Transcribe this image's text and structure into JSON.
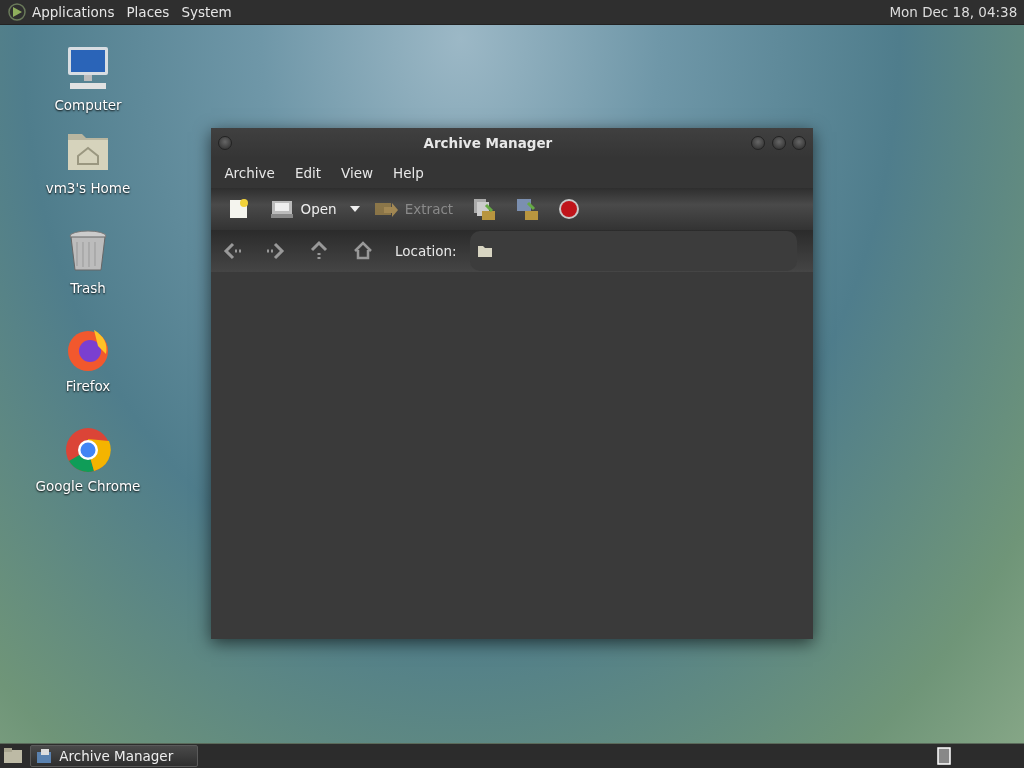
{
  "top_panel": {
    "menus": [
      "Applications",
      "Places",
      "System"
    ],
    "clock": "Mon Dec 18, 04:38"
  },
  "desktop_icons": [
    {
      "kind": "computer",
      "label": "Computer"
    },
    {
      "kind": "home",
      "label": "vm3's Home"
    },
    {
      "kind": "trash",
      "label": "Trash"
    },
    {
      "kind": "firefox",
      "label": "Firefox"
    },
    {
      "kind": "chrome",
      "label": "Google Chrome"
    }
  ],
  "window": {
    "title": "Archive Manager",
    "menu": [
      "Archive",
      "Edit",
      "View",
      "Help"
    ],
    "toolbar": [
      {
        "kind": "new",
        "disabled": false
      },
      {
        "kind": "open",
        "label": "Open",
        "disabled": false
      },
      {
        "kind": "extract",
        "label": "Extract",
        "disabled": true
      },
      {
        "kind": "add-files",
        "disabled": false
      },
      {
        "kind": "add-folder",
        "disabled": false
      },
      {
        "kind": "stop",
        "disabled": false
      }
    ],
    "location_label": "Location:"
  },
  "taskbar": {
    "tasks": [
      {
        "label": "Archive Manager"
      }
    ]
  }
}
